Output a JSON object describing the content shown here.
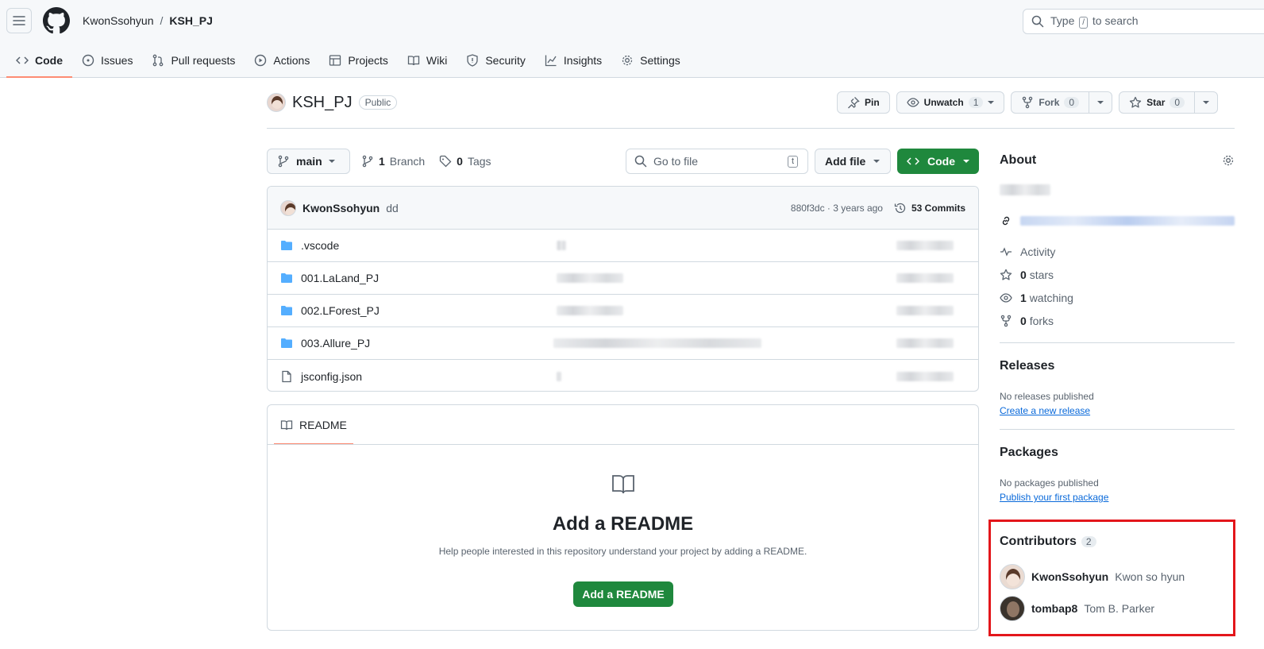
{
  "header": {
    "owner": "KwonSsohyun",
    "separator": "/",
    "repo": "KSH_PJ",
    "search_prefix": "Type",
    "search_key": "/",
    "search_suffix": "to search"
  },
  "tabs": [
    {
      "label": "Code",
      "icon": "code-icon"
    },
    {
      "label": "Issues",
      "icon": "issue-opened-icon"
    },
    {
      "label": "Pull requests",
      "icon": "git-pull-request-icon"
    },
    {
      "label": "Actions",
      "icon": "play-icon"
    },
    {
      "label": "Projects",
      "icon": "table-icon"
    },
    {
      "label": "Wiki",
      "icon": "book-icon"
    },
    {
      "label": "Security",
      "icon": "shield-icon"
    },
    {
      "label": "Insights",
      "icon": "graph-icon"
    },
    {
      "label": "Settings",
      "icon": "gear-icon"
    }
  ],
  "repo_header": {
    "name": "KSH_PJ",
    "visibility": "Public",
    "pin_label": "Pin",
    "unwatch_label": "Unwatch",
    "unwatch_count": "1",
    "fork_label": "Fork",
    "fork_count": "0",
    "star_label": "Star",
    "star_count": "0"
  },
  "file_nav": {
    "branch": "main",
    "branch_count": "1",
    "branch_label": "Branch",
    "tag_count": "0",
    "tag_label": "Tags",
    "goto_placeholder": "Go to file",
    "goto_key": "t",
    "add_file_label": "Add file",
    "code_label": "Code"
  },
  "commit": {
    "author": "KwonSsohyun",
    "message": "dd",
    "hash_time": "880f3dc · 3 years ago",
    "commits_label": "53 Commits"
  },
  "files": [
    {
      "name": ".vscode",
      "type": "folder"
    },
    {
      "name": "001.LaLand_PJ",
      "type": "folder"
    },
    {
      "name": "002.LForest_PJ",
      "type": "folder"
    },
    {
      "name": "003.Allure_PJ",
      "type": "folder"
    },
    {
      "name": "jsconfig.json",
      "type": "file"
    }
  ],
  "readme": {
    "tab_label": "README",
    "title": "Add a README",
    "description": "Help people interested in this repository understand your project by adding a README.",
    "button_label": "Add a README"
  },
  "sidebar": {
    "about_title": "About",
    "activity": "Activity",
    "stars_count": "0",
    "stars_label": "stars",
    "watching_count": "1",
    "watching_label": "watching",
    "forks_count": "0",
    "forks_label": "forks",
    "releases_title": "Releases",
    "releases_note": "No releases published",
    "releases_link": "Create a new release",
    "packages_title": "Packages",
    "packages_note": "No packages published",
    "packages_link": "Publish your first package",
    "contributors_title": "Contributors",
    "contributors_count": "2",
    "contributors": [
      {
        "login": "KwonSsohyun",
        "name": "Kwon so hyun"
      },
      {
        "login": "tombap8",
        "name": "Tom B. Parker"
      }
    ]
  },
  "colors": {
    "accent_tab": "#fd8c73",
    "primary_green": "#1f883d",
    "link_blue": "#0969da",
    "highlight_red": "#e3161b"
  }
}
